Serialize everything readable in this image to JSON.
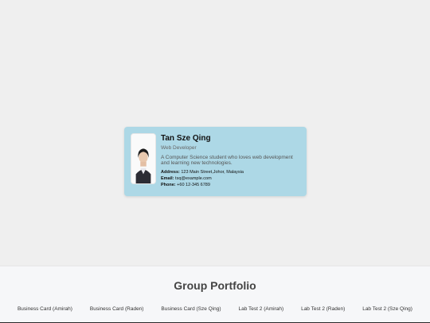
{
  "card": {
    "name": "Tan Sze Qing",
    "role": "Web Developer",
    "bio": "A Computer Science student who loves web development and learning new technologies.",
    "address_label": "Address:",
    "address_value": "123 Main Street,Johor, Malaysia",
    "email_label": "Email:",
    "email_value": "tsq@example.com",
    "phone_label": "Phone:",
    "phone_value": "+60 12-345 6789",
    "background_color": "#add8e6"
  },
  "footer": {
    "title": "Group Portfolio",
    "links": [
      "Business Card (Amirah)",
      "Business Card (Raden)",
      "Business Card (Sze Qing)",
      "Lab Test 2 (Amirah)",
      "Lab Test 2 (Raden)",
      "Lab Test 2 (Sze Qing)"
    ]
  }
}
